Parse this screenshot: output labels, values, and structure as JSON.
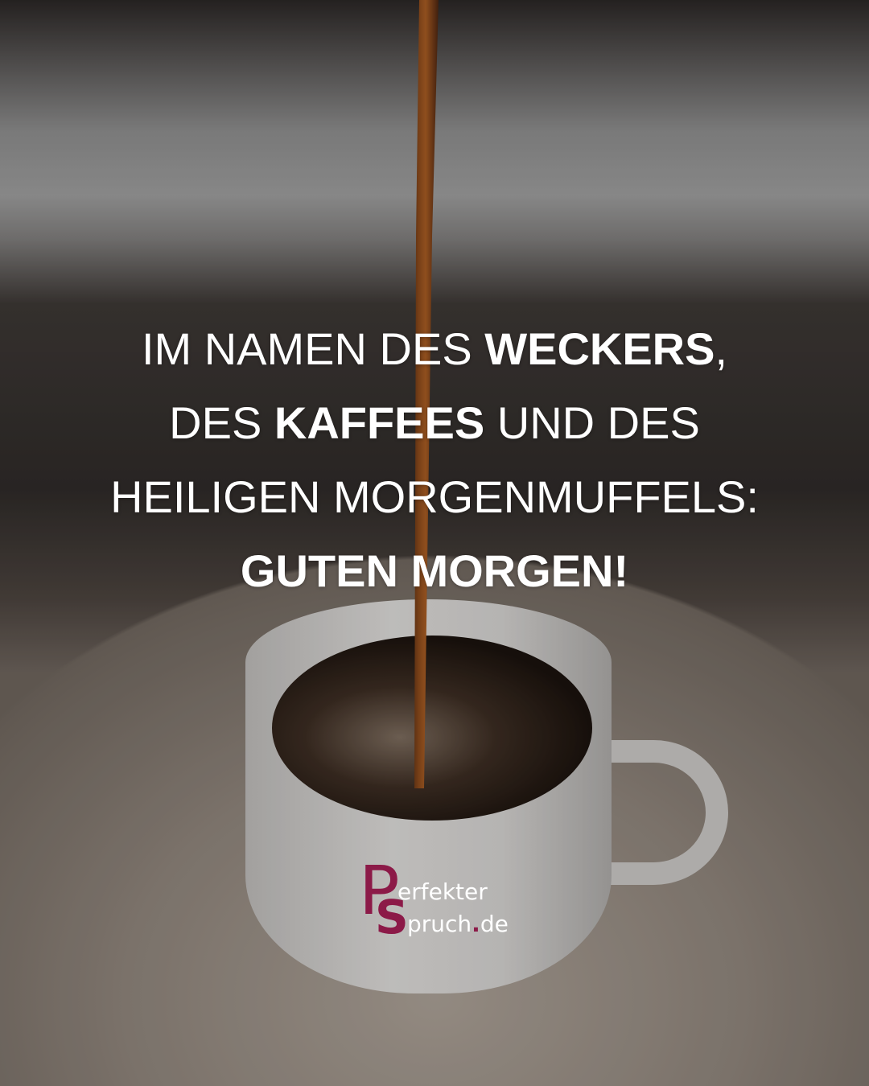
{
  "quote": {
    "lines": [
      [
        {
          "text": "IM NAMEN DES ",
          "bold": false
        },
        {
          "text": "WECKERS",
          "bold": true
        },
        {
          "text": ",",
          "bold": false
        }
      ],
      [
        {
          "text": "DES ",
          "bold": false
        },
        {
          "text": "KAFFEES",
          "bold": true
        },
        {
          "text": " UND DES",
          "bold": false
        }
      ],
      [
        {
          "text": "HEILIGEN MORGENMUFFELS:",
          "bold": false
        }
      ],
      [
        {
          "text": "GUTEN MORGEN!",
          "bold": true
        }
      ]
    ]
  },
  "logo": {
    "letter_p": "P",
    "letter_s": "S",
    "line1": "erfekter",
    "line2": "pruch",
    "dot": ".",
    "tld": "de",
    "brand_color": "#8c1a48"
  }
}
